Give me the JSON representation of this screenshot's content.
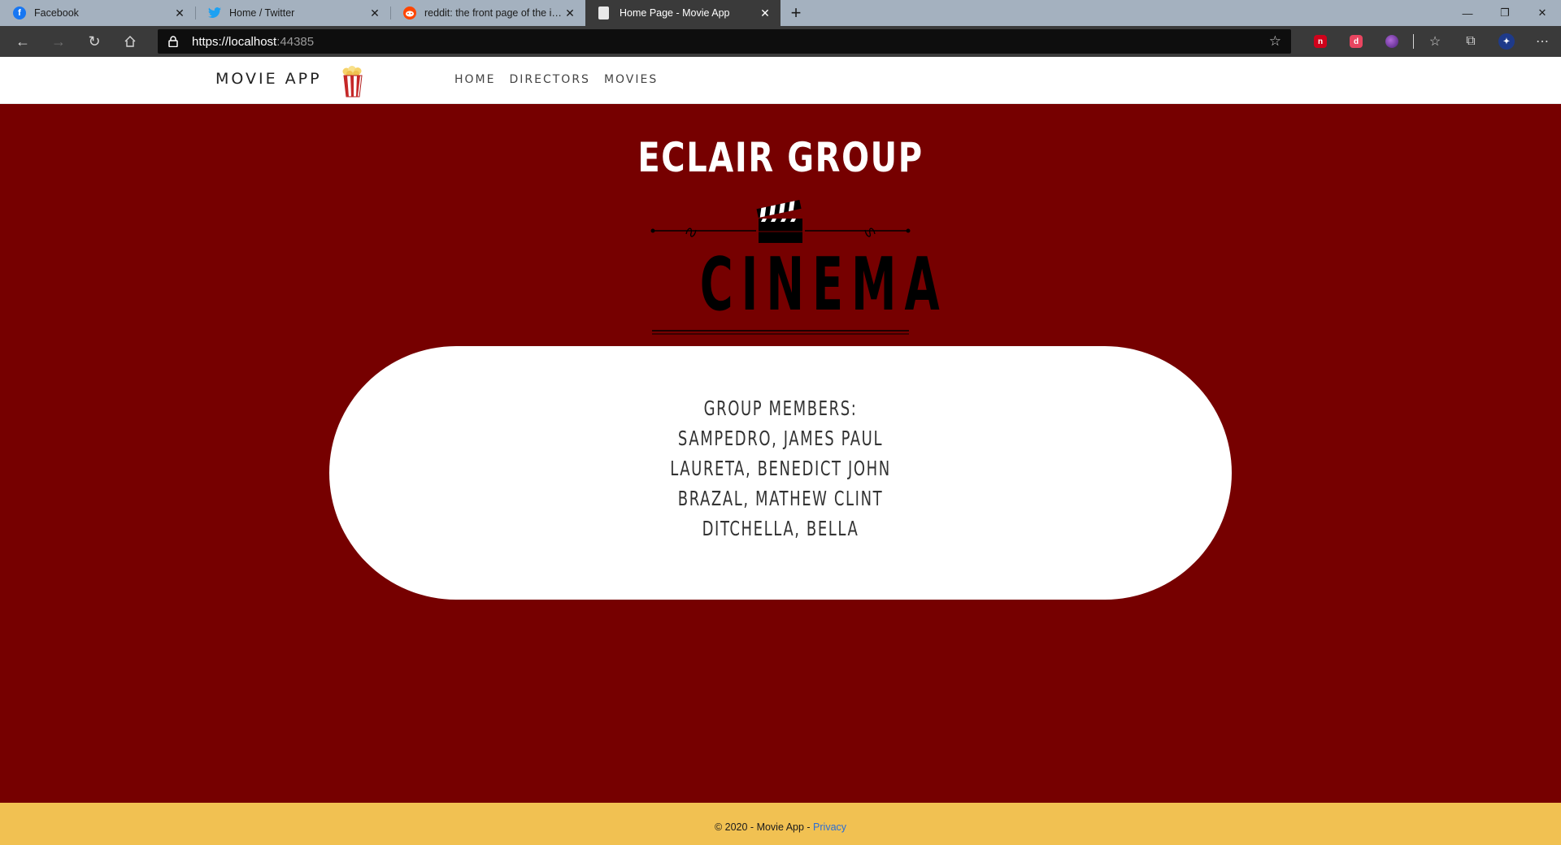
{
  "browser": {
    "tabs": [
      {
        "title": "Facebook",
        "icon": "facebook-icon",
        "color": "#1877f2",
        "active": false
      },
      {
        "title": "Home / Twitter",
        "icon": "twitter-icon",
        "color": "#1da1f2",
        "active": false
      },
      {
        "title": "reddit: the front page of the internet",
        "icon": "reddit-icon",
        "color": "#ff4500",
        "active": false
      },
      {
        "title": "Home Page - Movie App",
        "icon": "page-icon",
        "color": "#ffffff",
        "active": true
      }
    ],
    "new_tab_glyph": "+",
    "url_host": "https://localhost",
    "url_port": ":44385"
  },
  "site": {
    "brand": "MOVIE APP",
    "nav": [
      "HOME",
      "DIRECTORS",
      "MOVIES"
    ]
  },
  "hero": {
    "title": "ECLAIR GROUP",
    "emblem_text": "CINEMA"
  },
  "members": {
    "heading": "GROUP MEMBERS:",
    "list": [
      "SAMPEDRO, JAMES PAUL",
      "LAURETA, BENEDICT JOHN",
      "BRAZAL, MATHEW CLINT",
      "DITCHELLA, BELLA"
    ]
  },
  "footer": {
    "text": "© 2020 - Movie App - ",
    "link": "Privacy"
  },
  "colors": {
    "page_bg": "#760000",
    "footer_bg": "#f1c152",
    "link": "#2a6ed6"
  }
}
